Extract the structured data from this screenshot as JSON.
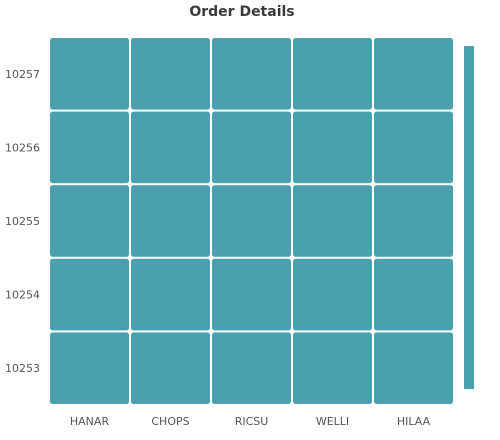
{
  "chart_data": {
    "type": "heatmap",
    "title": "Order Details",
    "xlabel": "",
    "ylabel": "",
    "x_categories": [
      "HANAR",
      "CHOPS",
      "RICSU",
      "WELLI",
      "HILAA"
    ],
    "y_categories": [
      "10257",
      "10256",
      "10255",
      "10254",
      "10253"
    ],
    "cell_color": "#4aa0ad",
    "cell_border_color": "#ffffff",
    "legend": {
      "type": "color-bar",
      "placement": "right",
      "color": "#4aa0ad"
    },
    "grid": false
  }
}
